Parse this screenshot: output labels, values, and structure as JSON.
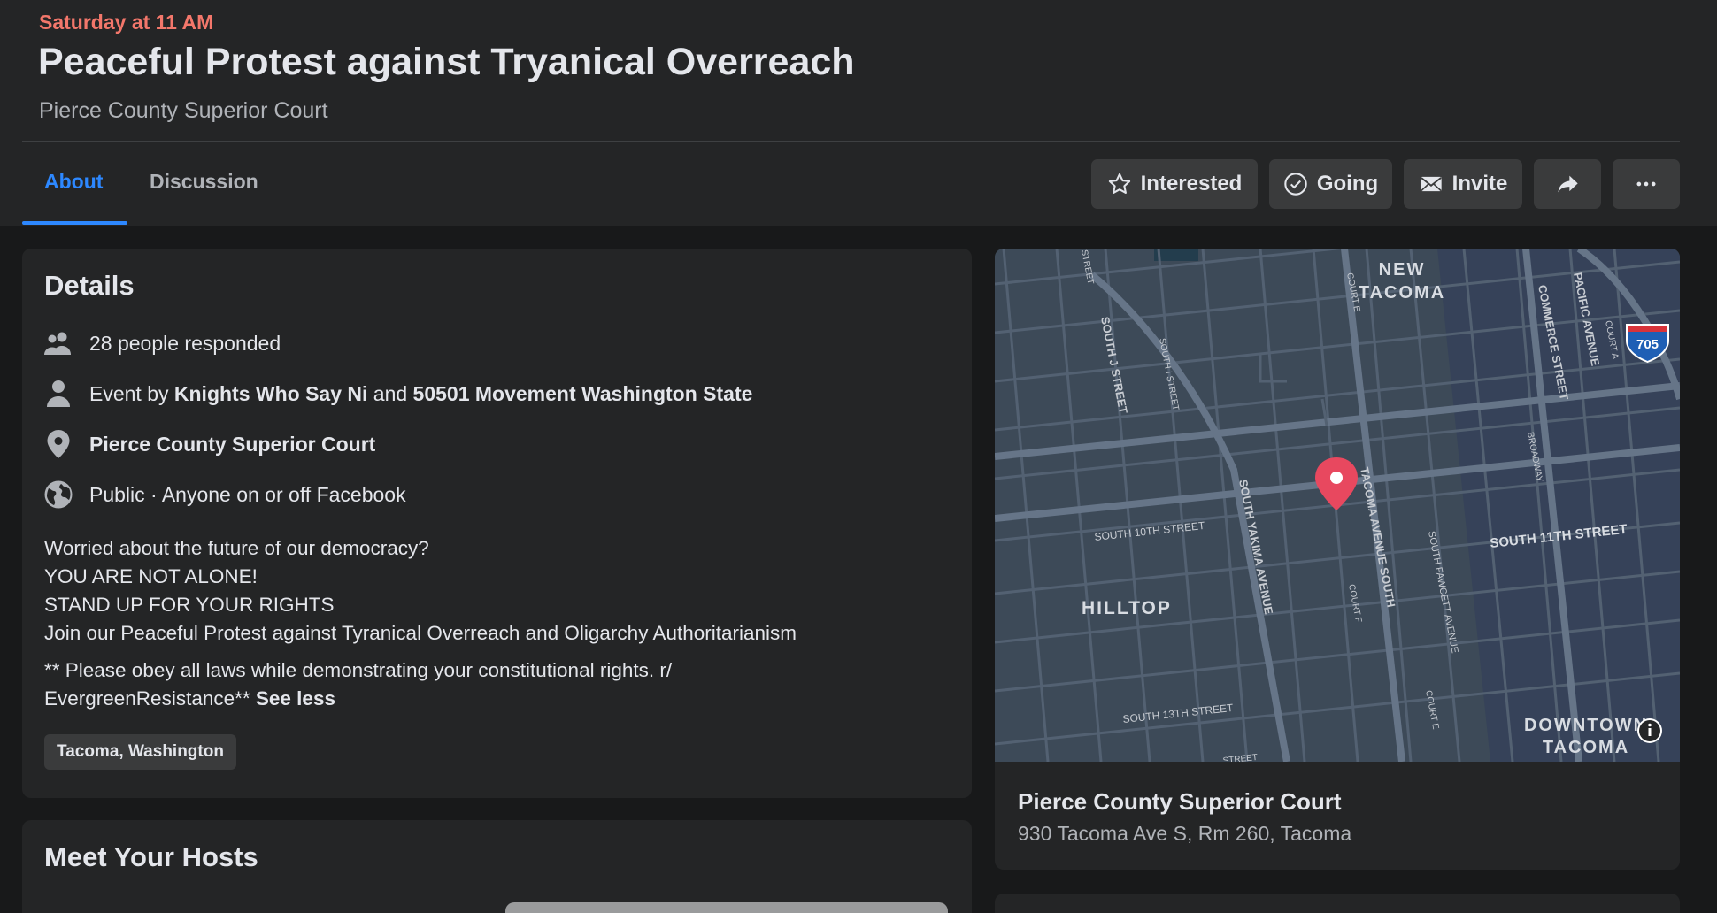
{
  "event": {
    "date": "Saturday at 11 AM",
    "title": "Peaceful Protest against Tryanical Overreach",
    "subtitle": "Pierce County Superior Court"
  },
  "tabs": [
    {
      "label": "About",
      "active": true
    },
    {
      "label": "Discussion",
      "active": false
    }
  ],
  "actions": {
    "interested": "Interested",
    "going": "Going",
    "invite": "Invite",
    "share_icon": "share-arrow-icon",
    "more_icon": "ellipsis-icon"
  },
  "details": {
    "heading": "Details",
    "responded": "28 people responded",
    "event_by_prefix": "Event by",
    "host1": "Knights Who Say Ni",
    "and": "and",
    "host2": "50501 Movement Washington State",
    "location": "Pierce County Superior Court",
    "privacy": "Public · Anyone on or off Facebook",
    "description_lines": [
      "Worried about the future of our democracy?",
      "YOU ARE NOT ALONE!",
      "STAND UP FOR YOUR RIGHTS",
      "Join our Peaceful Protest against Tyranical Overreach and Oligarchy Authoritarianism"
    ],
    "note_line1": "** Please obey all laws while demonstrating your constitutional rights. r/",
    "note_line2": "EvergreenResistance**",
    "see_less": "See less",
    "tag": "Tacoma, Washington"
  },
  "map": {
    "labels": {
      "new": "NEW",
      "tacoma": "TACOMA",
      "hilltop": "HILLTOP",
      "downtown": "DOWNTOWN",
      "downtown_tacoma": "TACOMA",
      "s_10th": "SOUTH 10TH STREET",
      "s_11th": "SOUTH 11TH STREET",
      "s_13th": "SOUTH 13TH STREET",
      "s_j": "SOUTH J STREET",
      "s_i": "SOUTH I STREET",
      "s_yakima": "SOUTH YAKIMA AVENUE",
      "tacoma_ave": "TACOMA AVENUE SOUTH",
      "s_fawcett": "SOUTH FAWCETT AVENUE",
      "commerce": "COMMERCE STREET",
      "pacific": "PACIFIC AVENUE",
      "broadway": "BROADWAY",
      "court_e": "COURT E",
      "court_e2": "COURT E",
      "court_f": "COURT F",
      "court_a": "COURT A",
      "street_top": "STREET",
      "street_bottom": "STREET",
      "shield": "705"
    },
    "colors": {
      "base": "#3d4a58",
      "road": "#536172",
      "major": "#667588",
      "water": "#233d4d",
      "pin": "#e8485f"
    }
  },
  "place": {
    "name": "Pierce County Superior Court",
    "address": "930 Tacoma Ave S, Rm 260, Tacoma"
  },
  "hosts": {
    "heading": "Meet Your Hosts"
  }
}
